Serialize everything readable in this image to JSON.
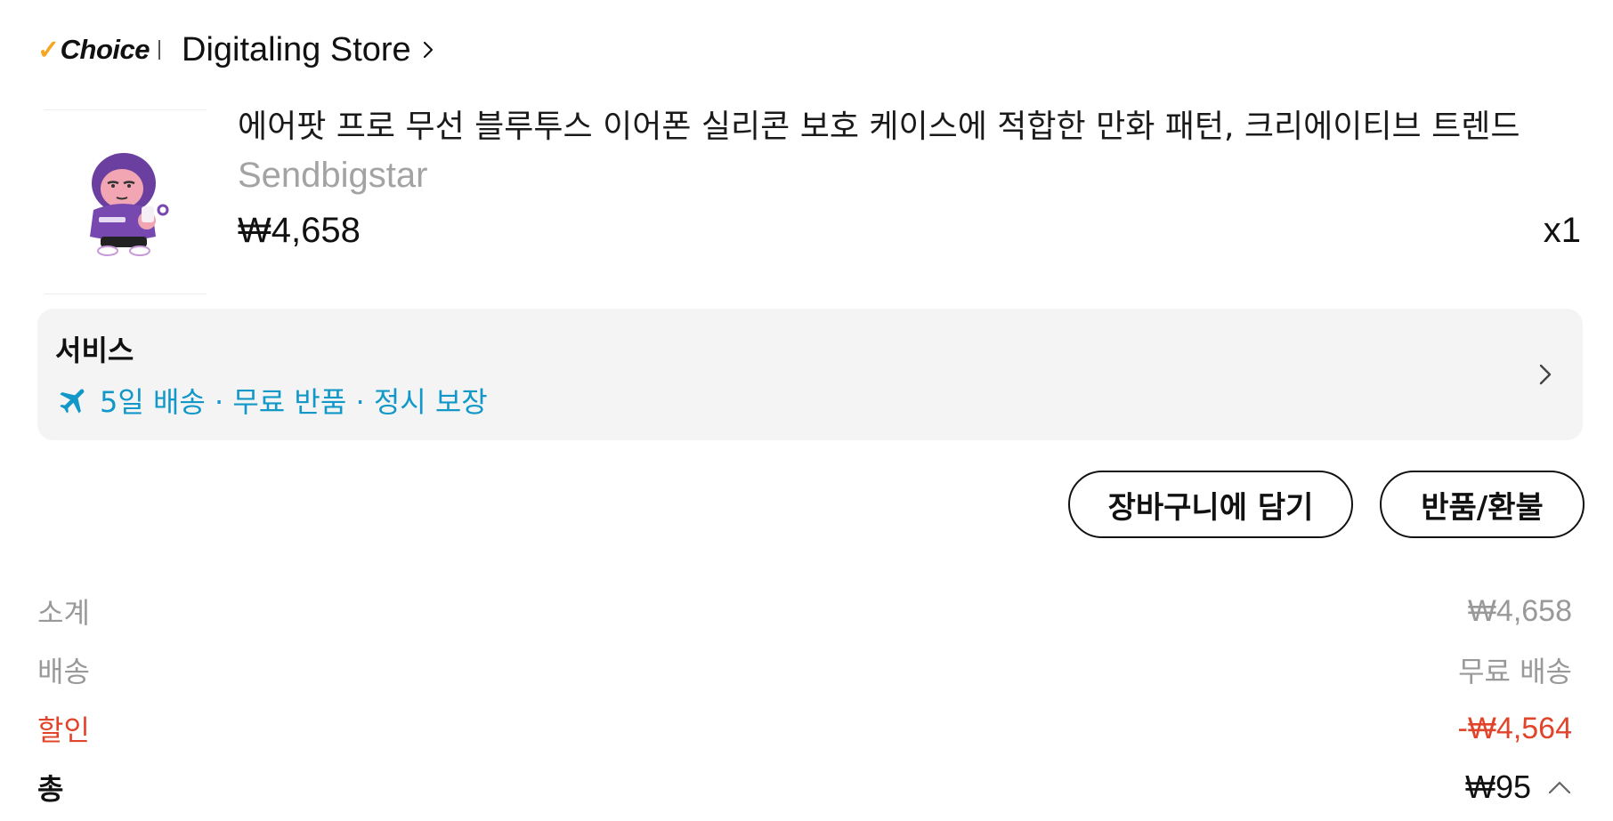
{
  "store": {
    "logo_text": "Choice",
    "name": "Digitaling Store"
  },
  "product": {
    "title": "에어팟 프로 무선 블루투스 이어폰 실리콘 보호 케이스에 적합한 만화 패턴, 크리에이티브 트렌드",
    "seller": "Sendbigstar",
    "price": "₩4,658",
    "quantity": "x1"
  },
  "service": {
    "title": "서비스",
    "details": "5일 배송 · 무료 반품 · 정시 보장"
  },
  "actions": {
    "add_to_cart": "장바구니에 담기",
    "return_refund": "반품/환불"
  },
  "summary": {
    "subtotal_label": "소계",
    "subtotal_value": "₩4,658",
    "shipping_label": "배송",
    "shipping_value": "무료 배송",
    "discount_label": "할인",
    "discount_value": "-₩4,564",
    "total_label": "총",
    "total_value": "₩95"
  },
  "colors": {
    "accent_check": "#f5a623",
    "service_blue": "#1198c8",
    "discount_red": "#e0452b",
    "hoodie_purple": "#6b3fa0"
  },
  "icons": {
    "store_chevron": "chevron-right-icon",
    "service_plane": "airplane-icon",
    "service_chevron": "chevron-right-icon",
    "total_toggle": "chevron-up-icon"
  }
}
